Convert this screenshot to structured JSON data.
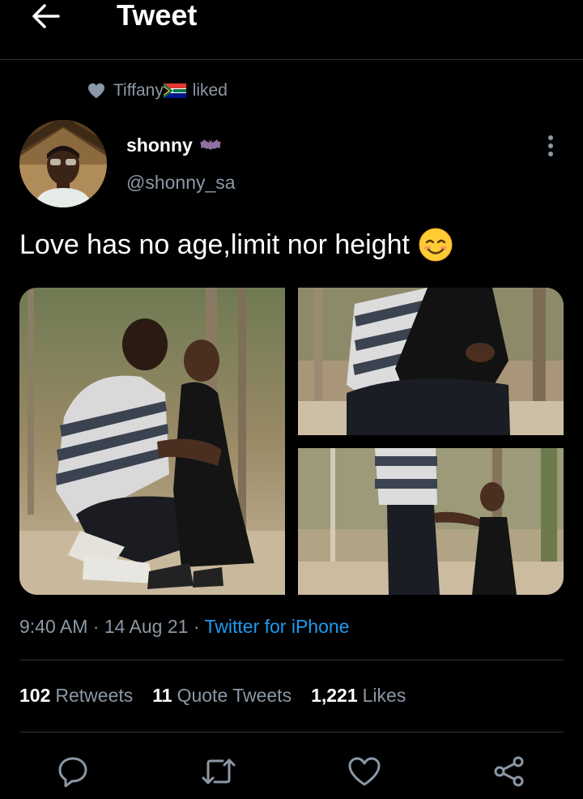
{
  "header": {
    "title": "Tweet",
    "back_icon": "arrow-left-icon"
  },
  "social_context": {
    "user": "Tiffany",
    "flag": "south-africa-flag-icon",
    "action": "liked",
    "icon": "heart-icon"
  },
  "author": {
    "display_name": "shonny",
    "badge_icon": "bat-emoji-icon",
    "handle": "@shonny_sa"
  },
  "tweet": {
    "text": "Love has no age,limit nor height",
    "emoji_icon": "smiling-face-icon"
  },
  "meta": {
    "time": "9:40 AM",
    "separator": "·",
    "date": "14 Aug 21",
    "source": "Twitter for iPhone"
  },
  "stats": {
    "retweets_count": "102",
    "retweets_label": "Retweets",
    "quotes_count": "11",
    "quotes_label": "Quote Tweets",
    "likes_count": "1,221",
    "likes_label": "Likes"
  },
  "actions": [
    "reply-icon",
    "retweet-icon",
    "like-icon",
    "share-icon"
  ],
  "colors": {
    "background": "#000000",
    "text": "#e7e9ea",
    "muted": "#8b98a5",
    "link": "#1d9bf0",
    "divider": "#2f3336"
  }
}
